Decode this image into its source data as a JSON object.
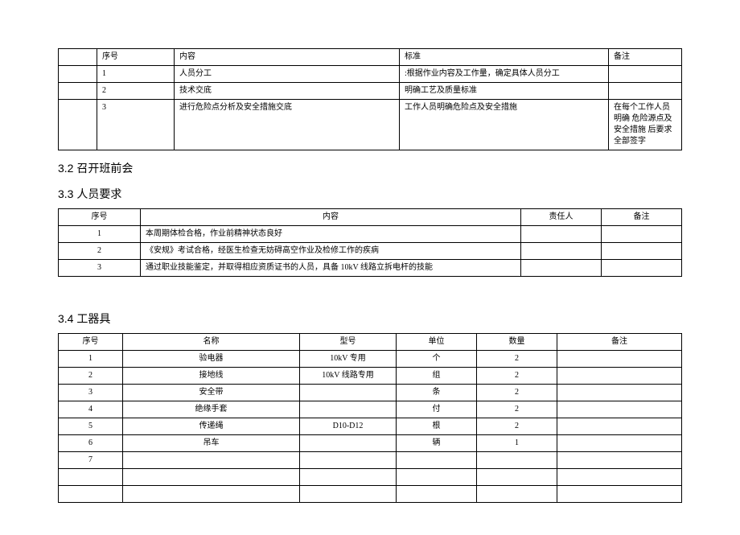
{
  "table1": {
    "headers": [
      "",
      "序号",
      "内容",
      "标准",
      "备注"
    ],
    "rows": [
      [
        "",
        "1",
        "人员分工",
        ":根据作业内容及工作量，确定具体人员分工",
        ""
      ],
      [
        "",
        "2",
        "技术交底",
        "明确工艺及质量标准",
        ""
      ],
      [
        "",
        "3",
        "进行危险点分析及安全措施交底",
        "工作人员明确危险点及安全措施",
        "在每个工作人员明确 危险源点及安全措施 后要求全部签字"
      ]
    ]
  },
  "heading_32": "3.2 召开班前会",
  "heading_33": "3.3 人员要求",
  "table2": {
    "headers": [
      "序号",
      "内容",
      "责任人",
      "备注"
    ],
    "rows": [
      [
        "1",
        "本周期体检合格，作业前精神状态良好",
        "",
        ""
      ],
      [
        "2",
        "《安规》考试合格，经医生检查无妨碍高空作业及检修工作的疾病",
        "",
        ""
      ],
      [
        "3",
        "通过职业技能鉴定，并取得相应资质证书的人员，具备 10kV 线路立拆电杆的技能",
        "",
        ""
      ]
    ]
  },
  "heading_34": "3.4 工器具",
  "table3": {
    "headers": [
      "序号",
      "名称",
      "型号",
      "单位",
      "数量",
      "备注"
    ],
    "rows": [
      [
        "1",
        "验电器",
        "10kV 专用",
        "个",
        "2",
        ""
      ],
      [
        "2",
        "接地线",
        "10kV 线路专用",
        "组",
        "2",
        ""
      ],
      [
        "3",
        "安全带",
        "",
        "条",
        "2",
        ""
      ],
      [
        "4",
        "绝缘手套",
        "",
        "付",
        "2",
        ""
      ],
      [
        "5",
        "传递绳",
        "D10-D12",
        "根",
        "2",
        ""
      ],
      [
        "6",
        "吊车",
        "",
        "辆",
        "1",
        ""
      ],
      [
        "7",
        "",
        "",
        "",
        "",
        ""
      ],
      [
        "",
        "",
        "",
        "",
        "",
        ""
      ],
      [
        "",
        "",
        "",
        "",
        "",
        ""
      ]
    ]
  }
}
